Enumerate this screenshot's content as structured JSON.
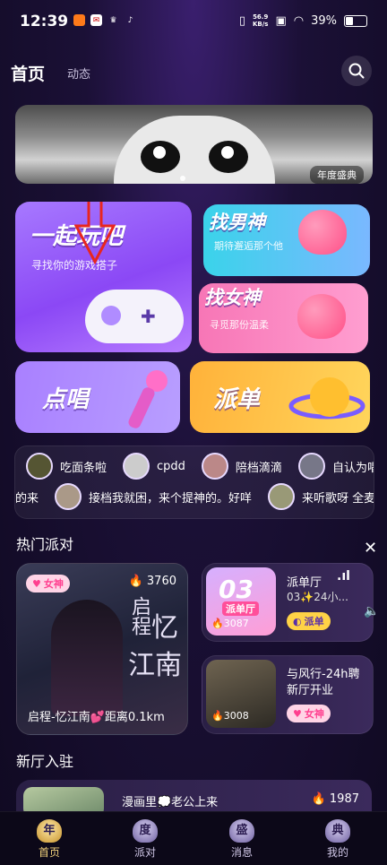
{
  "status_bar": {
    "time": "12:39",
    "net_speed_top": "56.9",
    "net_speed_bottom": "KB/s",
    "battery": "39%"
  },
  "header": {
    "tab_home": "首页",
    "tab_dynamic": "动态"
  },
  "banner": {
    "tag": "年度盛典"
  },
  "features": {
    "play": {
      "title": "一起玩吧",
      "subtitle": "寻找你的游戏搭子"
    },
    "male": {
      "title": "找男神",
      "subtitle": "期待邂逅那个他"
    },
    "female": {
      "title": "找女神",
      "subtitle": "寻觅那份温柔"
    },
    "sing": {
      "title": "点唱"
    },
    "order": {
      "title": "派单"
    }
  },
  "marquee": {
    "row1": [
      {
        "name": "吃面条啦"
      },
      {
        "name": "cpdd"
      },
      {
        "name": "陪档滴滴"
      },
      {
        "name": "自认为唱小宇"
      }
    ],
    "row2": [
      {
        "name": "的来"
      },
      {
        "name": "接档我就困，来个提神的。好咩"
      },
      {
        "name": "来听歌呀 全麦优质"
      }
    ]
  },
  "hot_party": {
    "title": "热门派对",
    "big": {
      "badge": "女神",
      "hot": "3760",
      "caption": "启程-忆江南💕距离0.1km",
      "art_text_1": "启程",
      "art_text_2": "忆",
      "art_text_3": "江南"
    },
    "items": [
      {
        "title": "派单厅",
        "subtitle": "03✨24小...",
        "hot": "3087",
        "badge": "派单",
        "thumb_text": "03",
        "thumb_label": "派单厅"
      },
      {
        "title": "与风行-24h聘新厅开业",
        "hot": "3008",
        "badge": "女神"
      }
    ]
  },
  "new_rooms": {
    "title": "新厅入驻",
    "item": {
      "title": "漫画里💭老公上来",
      "hot": "1987"
    }
  },
  "nav": [
    {
      "label": "首页",
      "icon": "年"
    },
    {
      "label": "派对",
      "icon": "度"
    },
    {
      "label": "消息",
      "icon": "盛"
    },
    {
      "label": "我的",
      "icon": "典"
    }
  ],
  "colors": {
    "accent_pink": "#ff5fa2",
    "nav_active": "#f2d27c",
    "fire": "#ff8a2a"
  }
}
